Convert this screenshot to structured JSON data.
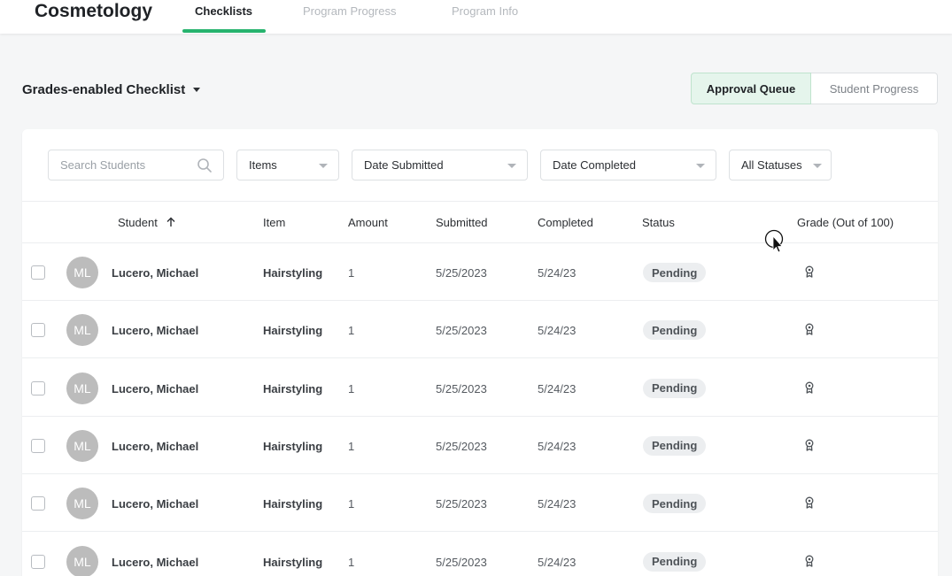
{
  "header": {
    "app_title": "Cosmetology",
    "tabs": [
      {
        "label": "Checklists",
        "active": true
      },
      {
        "label": "Program Progress",
        "active": false
      },
      {
        "label": "Program Info",
        "active": false
      }
    ]
  },
  "toolbar": {
    "checklist_label": "Grades-enabled Checklist",
    "view_toggle": [
      "Approval Queue",
      "Student Progress"
    ]
  },
  "filters": {
    "search_placeholder": "Search Students",
    "items_label": "Items",
    "date_submitted_label": "Date Submitted",
    "date_completed_label": "Date Completed",
    "status_label": "All Statuses"
  },
  "table": {
    "columns": [
      "Student",
      "Item",
      "Amount",
      "Submitted",
      "Completed",
      "Status",
      "Grade (Out of 100)"
    ],
    "rows": [
      {
        "initials": "ML",
        "student": "Lucero, Michael",
        "item": "Hairstyling",
        "amount": "1",
        "submitted": "5/25/2023",
        "completed": "5/24/23",
        "status": "Pending"
      },
      {
        "initials": "ML",
        "student": "Lucero, Michael",
        "item": "Hairstyling",
        "amount": "1",
        "submitted": "5/25/2023",
        "completed": "5/24/23",
        "status": "Pending"
      },
      {
        "initials": "ML",
        "student": "Lucero, Michael",
        "item": "Hairstyling",
        "amount": "1",
        "submitted": "5/25/2023",
        "completed": "5/24/23",
        "status": "Pending"
      },
      {
        "initials": "ML",
        "student": "Lucero, Michael",
        "item": "Hairstyling",
        "amount": "1",
        "submitted": "5/25/2023",
        "completed": "5/24/23",
        "status": "Pending"
      },
      {
        "initials": "ML",
        "student": "Lucero, Michael",
        "item": "Hairstyling",
        "amount": "1",
        "submitted": "5/25/2023",
        "completed": "5/24/23",
        "status": "Pending"
      },
      {
        "initials": "ML",
        "student": "Lucero, Michael",
        "item": "Hairstyling",
        "amount": "1",
        "submitted": "5/25/2023",
        "completed": "5/24/23",
        "status": "Pending"
      }
    ]
  },
  "colors": {
    "accent": "#27b36e",
    "active_toggle_bg": "#e5f5ec",
    "avatar_bg": "#bcbcbc"
  },
  "icons": {
    "search": "search-icon",
    "sort": "arrow-up-icon",
    "grade": "award-icon",
    "cursor": "mouse-pointer-icon"
  }
}
